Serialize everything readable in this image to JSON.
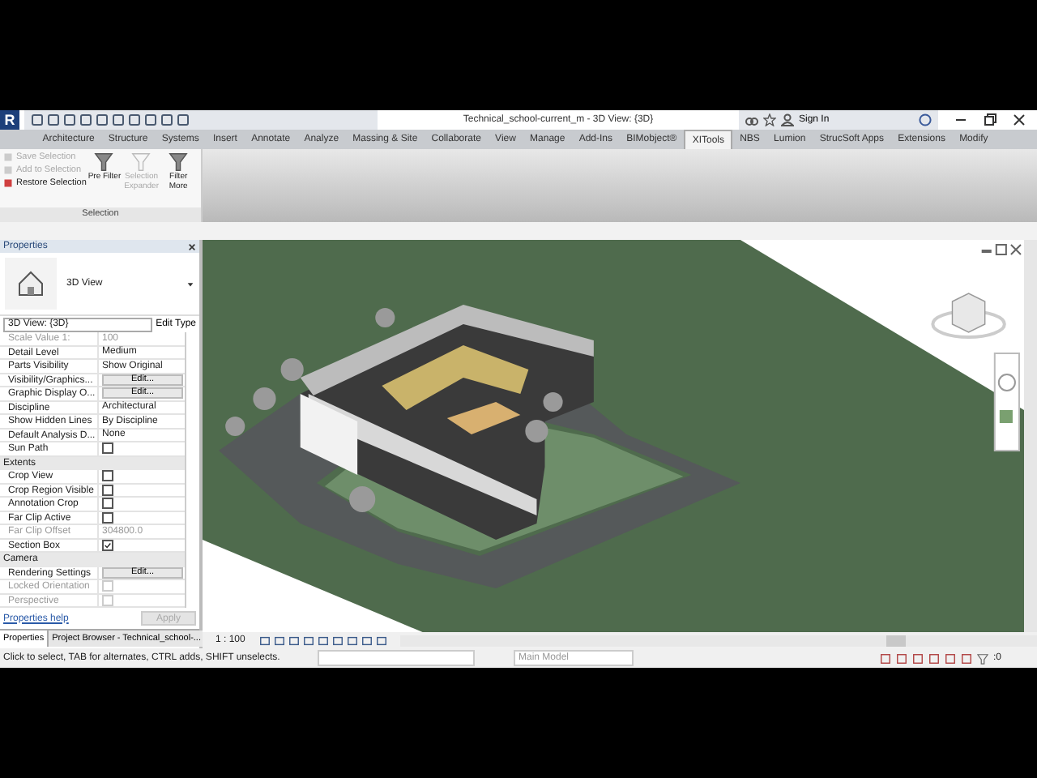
{
  "titlebar": {
    "logo": "R",
    "title": "Technical_school-current_m - 3D View: {3D}",
    "sign_in": "Sign In"
  },
  "tabs": [
    {
      "label": "Architecture",
      "selected": false
    },
    {
      "label": "Structure",
      "selected": false
    },
    {
      "label": "Systems",
      "selected": false
    },
    {
      "label": "Insert",
      "selected": false
    },
    {
      "label": "Annotate",
      "selected": false
    },
    {
      "label": "Analyze",
      "selected": false
    },
    {
      "label": "Massing & Site",
      "selected": false
    },
    {
      "label": "Collaborate",
      "selected": false
    },
    {
      "label": "View",
      "selected": false
    },
    {
      "label": "Manage",
      "selected": false
    },
    {
      "label": "Add-Ins",
      "selected": false
    },
    {
      "label": "BIMobject®",
      "selected": false
    },
    {
      "label": "XITools",
      "selected": true
    },
    {
      "label": "NBS",
      "selected": false
    },
    {
      "label": "Lumion",
      "selected": false
    },
    {
      "label": "StrucSoft Apps",
      "selected": false
    },
    {
      "label": "Extensions",
      "selected": false
    },
    {
      "label": "Modify",
      "selected": false
    }
  ],
  "ribbon": {
    "panel_label": "Selection",
    "small_buttons": [
      {
        "label": "Save Selection",
        "disabled": true
      },
      {
        "label": "Add to Selection",
        "disabled": true
      },
      {
        "label": "Restore Selection",
        "disabled": false
      }
    ],
    "large_buttons": [
      {
        "label": "Pre Filter",
        "disabled": false
      },
      {
        "label": "Selection Expander",
        "disabled": true
      },
      {
        "label": "Filter More",
        "disabled": false
      }
    ]
  },
  "properties": {
    "title": "Properties",
    "type_name": "3D View",
    "instance": "3D View: {3D}",
    "edit_type": "Edit Type",
    "rows": [
      {
        "kind": "value",
        "name": "Scale Value  1:",
        "value": "100",
        "disabled": true
      },
      {
        "kind": "value",
        "name": "Detail Level",
        "value": "Medium",
        "disabled": false
      },
      {
        "kind": "value",
        "name": "Parts Visibility",
        "value": "Show Original",
        "disabled": false
      },
      {
        "kind": "button",
        "name": "Visibility/Graphics...",
        "value": "Edit...",
        "disabled": false
      },
      {
        "kind": "button",
        "name": "Graphic Display O...",
        "value": "Edit...",
        "disabled": false
      },
      {
        "kind": "value",
        "name": "Discipline",
        "value": "Architectural",
        "disabled": false
      },
      {
        "kind": "value",
        "name": "Show Hidden Lines",
        "value": "By Discipline",
        "disabled": false
      },
      {
        "kind": "value",
        "name": "Default Analysis D...",
        "value": "None",
        "disabled": false
      },
      {
        "kind": "check",
        "name": "Sun Path",
        "checked": false,
        "disabled": false
      },
      {
        "kind": "section",
        "name": "Extents"
      },
      {
        "kind": "check",
        "name": "Crop View",
        "checked": false,
        "disabled": false
      },
      {
        "kind": "check",
        "name": "Crop Region Visible",
        "checked": false,
        "disabled": false
      },
      {
        "kind": "check",
        "name": "Annotation Crop",
        "checked": false,
        "disabled": false
      },
      {
        "kind": "check",
        "name": "Far Clip Active",
        "checked": false,
        "disabled": false
      },
      {
        "kind": "value",
        "name": "Far Clip Offset",
        "value": "304800.0",
        "disabled": true
      },
      {
        "kind": "check",
        "name": "Section Box",
        "checked": true,
        "disabled": false
      },
      {
        "kind": "section",
        "name": "Camera"
      },
      {
        "kind": "button",
        "name": "Rendering Settings",
        "value": "Edit...",
        "disabled": false
      },
      {
        "kind": "check",
        "name": "Locked Orientation",
        "checked": false,
        "disabled": true
      },
      {
        "kind": "check",
        "name": "Perspective",
        "checked": false,
        "disabled": true
      }
    ],
    "help": "Properties help",
    "apply": "Apply",
    "tabs": [
      {
        "label": "Properties",
        "selected": true
      },
      {
        "label": "Project Browser - Technical_school-...",
        "selected": false
      }
    ]
  },
  "view": {
    "scale": "1 : 100"
  },
  "status": {
    "message": "Click to select, TAB for alternates, CTRL adds, SHIFT unselects.",
    "model": "Main Model",
    "filter_count": ":0"
  }
}
